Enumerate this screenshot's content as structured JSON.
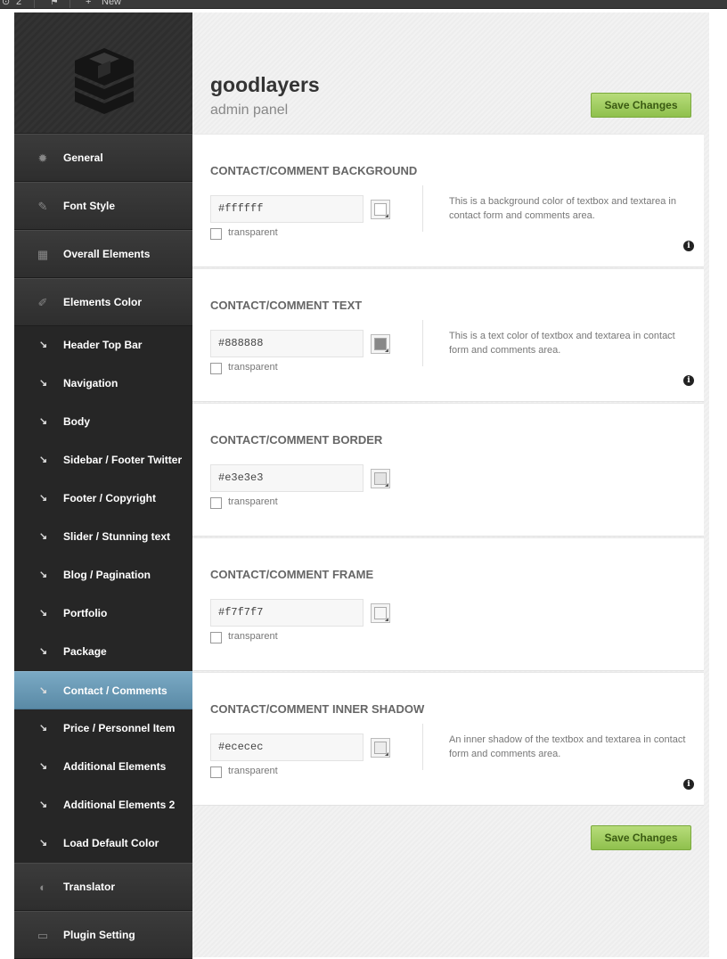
{
  "admin_bar": {
    "comments_count": "2",
    "new_label": "New"
  },
  "brand": {
    "title": "goodlayers",
    "subtitle": "admin panel"
  },
  "buttons": {
    "save_top": "Save Changes",
    "save_bottom": "Save Changes"
  },
  "sidebar": {
    "main_items": [
      {
        "label": "General",
        "icon": "gear-icon"
      },
      {
        "label": "Font Style",
        "icon": "pencil-icon"
      },
      {
        "label": "Overall Elements",
        "icon": "layout-icon"
      },
      {
        "label": "Elements Color",
        "icon": "brush-icon"
      },
      {
        "label": "Translator",
        "icon": "pacman-icon"
      },
      {
        "label": "Plugin Setting",
        "icon": "monitor-icon"
      }
    ],
    "sub_items": [
      {
        "label": "Header Top Bar"
      },
      {
        "label": "Navigation"
      },
      {
        "label": "Body"
      },
      {
        "label": "Sidebar / Footer Twitter"
      },
      {
        "label": "Footer / Copyright"
      },
      {
        "label": "Slider / Stunning text"
      },
      {
        "label": "Blog / Pagination"
      },
      {
        "label": "Portfolio"
      },
      {
        "label": "Package"
      },
      {
        "label": "Contact / Comments",
        "active": true
      },
      {
        "label": "Price / Personnel Item"
      },
      {
        "label": "Additional Elements"
      },
      {
        "label": "Additional Elements 2"
      },
      {
        "label": "Load Default Color"
      }
    ],
    "sub_arrow": "↘"
  },
  "sections": [
    {
      "title": "CONTACT/COMMENT BACKGROUND",
      "value": "#ffffff",
      "swatch_color": "#ffffff",
      "transparent_label": "transparent",
      "description": "This is a background color of textbox and textarea in contact form and comments area."
    },
    {
      "title": "CONTACT/COMMENT TEXT",
      "value": "#888888",
      "swatch_color": "#888888",
      "transparent_label": "transparent",
      "description": "This is a text color of textbox and textarea in contact form and comments area."
    },
    {
      "title": "CONTACT/COMMENT BORDER",
      "value": "#e3e3e3",
      "swatch_color": "#e3e3e3",
      "transparent_label": "transparent",
      "description": ""
    },
    {
      "title": "CONTACT/COMMENT FRAME",
      "value": "#f7f7f7",
      "swatch_color": "#f7f7f7",
      "transparent_label": "transparent",
      "description": ""
    },
    {
      "title": "CONTACT/COMMENT INNER SHADOW",
      "value": "#ececec",
      "swatch_color": "#ececec",
      "transparent_label": "transparent",
      "description": "An inner shadow of the textbox and textarea in contact form and comments area."
    }
  ],
  "info_glyph": "i",
  "colors": {
    "accent_green": "#8fc04d",
    "active_blue": "#6b9bb8",
    "sidebar_dark": "#2b2b2b"
  }
}
